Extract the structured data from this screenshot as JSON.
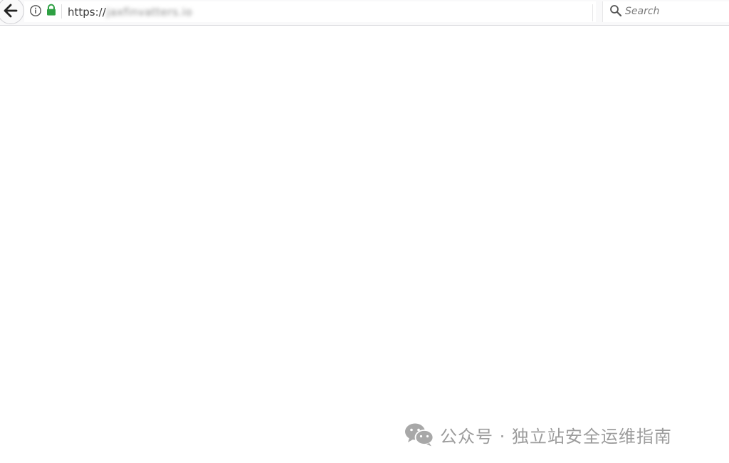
{
  "browser": {
    "address_bar": {
      "scheme": "https://",
      "host_blurred": "jaxfinvatters.io"
    },
    "search_bar": {
      "placeholder": "Search"
    }
  },
  "watermark": {
    "text": "公众号 · 独立站安全运维指南"
  },
  "colors": {
    "lock_green": "#2ea043",
    "watermark_gray": "#9c9c9c",
    "toolbar_bg": "#f9f9fa"
  },
  "icons": {
    "back": "arrow-left-icon",
    "info": "info-icon",
    "lock": "lock-icon",
    "reload": "reload-icon",
    "search": "search-icon",
    "wechat": "wechat-logo-icon"
  }
}
